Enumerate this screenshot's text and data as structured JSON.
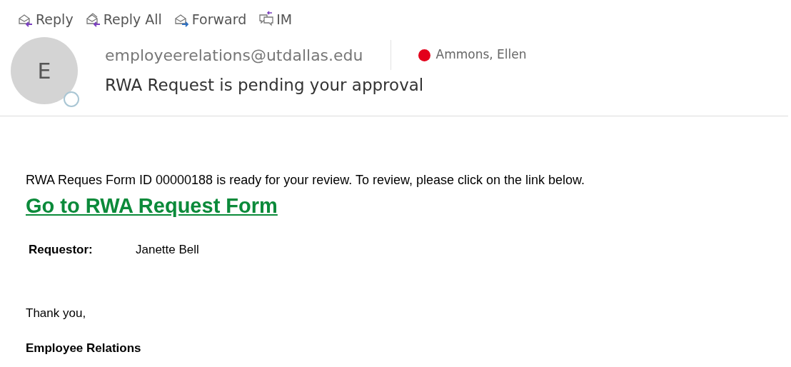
{
  "toolbar": [
    {
      "label": "Reply",
      "kind": "reply"
    },
    {
      "label": "Reply All",
      "kind": "reply-all"
    },
    {
      "label": "Forward",
      "kind": "forward"
    },
    {
      "label": "IM",
      "kind": "im"
    }
  ],
  "header": {
    "avatar": "E",
    "sender": "employeerelations@utdallas.edu",
    "recipient": {
      "name": "Ammons, Ellen",
      "color": "#e3001b"
    },
    "subject": "RWA Request is pending your approval"
  },
  "body": {
    "intro": "RWA Reques Form ID 00000188 is ready for your review. To review, please click on the link below.",
    "link": "Go to RWA Request Form",
    "requestor_label": "Requestor:",
    "requestor": "Janette Bell",
    "closing": "Thank you,",
    "signature": "Employee Relations"
  }
}
